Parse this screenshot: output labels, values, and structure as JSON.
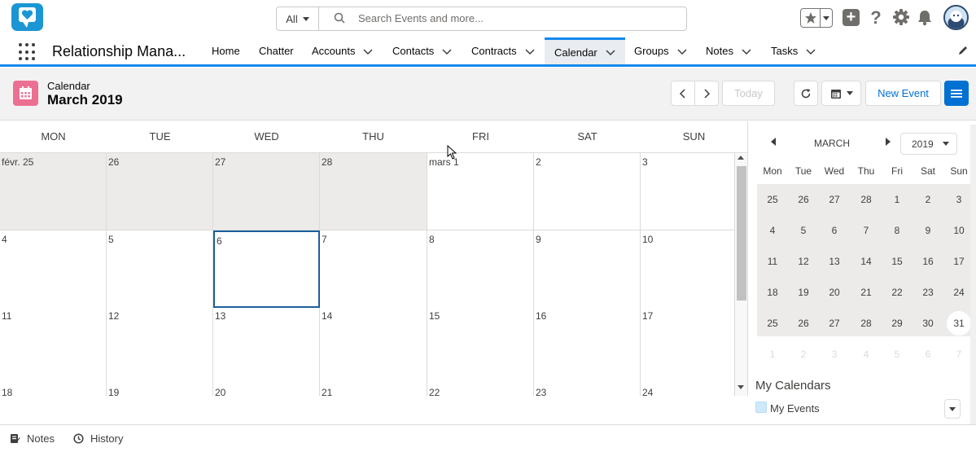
{
  "global_header": {
    "search_scope": "All",
    "search_placeholder": "Search Events and more..."
  },
  "app_nav": {
    "app_name": "Relationship Mana...",
    "items": [
      {
        "label": "Home",
        "has_menu": false
      },
      {
        "label": "Chatter",
        "has_menu": false
      },
      {
        "label": "Accounts",
        "has_menu": true
      },
      {
        "label": "Contacts",
        "has_menu": true
      },
      {
        "label": "Contracts",
        "has_menu": true
      },
      {
        "label": "Calendar",
        "has_menu": true,
        "active": true
      },
      {
        "label": "Groups",
        "has_menu": true
      },
      {
        "label": "Notes",
        "has_menu": true
      },
      {
        "label": "Tasks",
        "has_menu": true
      }
    ]
  },
  "page_header": {
    "object_label": "Calendar",
    "title": "March 2019",
    "today_label": "Today",
    "new_event_label": "New Event"
  },
  "calendar": {
    "weekdays": [
      "MON",
      "TUE",
      "WED",
      "THU",
      "FRI",
      "SAT",
      "SUN"
    ],
    "weeks": [
      [
        {
          "d": "févr. 25",
          "other": true
        },
        {
          "d": "26",
          "other": true
        },
        {
          "d": "27",
          "other": true
        },
        {
          "d": "28",
          "other": true
        },
        {
          "d": "mars 1"
        },
        {
          "d": "2"
        },
        {
          "d": "3"
        }
      ],
      [
        {
          "d": "4"
        },
        {
          "d": "5"
        },
        {
          "d": "6",
          "selected": true
        },
        {
          "d": "7"
        },
        {
          "d": "8"
        },
        {
          "d": "9"
        },
        {
          "d": "10"
        }
      ],
      [
        {
          "d": "11"
        },
        {
          "d": "12"
        },
        {
          "d": "13"
        },
        {
          "d": "14"
        },
        {
          "d": "15"
        },
        {
          "d": "16"
        },
        {
          "d": "17"
        }
      ],
      [
        {
          "d": "18"
        },
        {
          "d": "19"
        },
        {
          "d": "20"
        },
        {
          "d": "21"
        },
        {
          "d": "22"
        },
        {
          "d": "23"
        },
        {
          "d": "24"
        }
      ]
    ]
  },
  "mini_calendar": {
    "month": "MARCH",
    "year": "2019",
    "weekdays": [
      "Mon",
      "Tue",
      "Wed",
      "Thu",
      "Fri",
      "Sat",
      "Sun"
    ],
    "weeks": [
      [
        "25",
        "26",
        "27",
        "28",
        "1",
        "2",
        "3"
      ],
      [
        "4",
        "5",
        "6",
        "7",
        "8",
        "9",
        "10"
      ],
      [
        "11",
        "12",
        "13",
        "14",
        "15",
        "16",
        "17"
      ],
      [
        "18",
        "19",
        "20",
        "21",
        "22",
        "23",
        "24"
      ],
      [
        "25",
        "26",
        "27",
        "28",
        "29",
        "30",
        "31"
      ],
      [
        "1",
        "2",
        "3",
        "4",
        "5",
        "6",
        "7"
      ]
    ],
    "today": "31",
    "my_calendars_title": "My Calendars",
    "my_events_label": "My Events"
  },
  "utility_bar": {
    "notes_label": "Notes",
    "history_label": "History"
  },
  "colors": {
    "brand_blue": "#1589ee",
    "button_blue": "#0070d2",
    "calendar_icon_pink": "#eb7092",
    "selected_day_border": "#1b5f9e",
    "other_month_bg": "#ecebea"
  }
}
